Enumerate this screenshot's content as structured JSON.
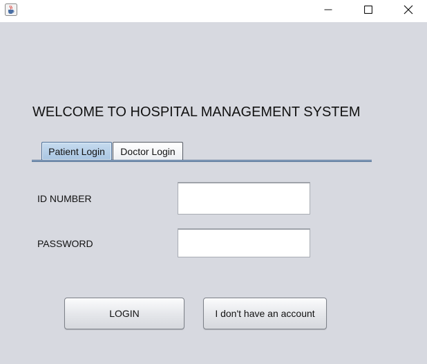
{
  "window": {
    "icon": "java-cup-icon",
    "controls": [
      "minimize-icon",
      "maximize-icon",
      "close-icon"
    ]
  },
  "main": {
    "welcome_text": "WELCOME TO HOSPITAL MANAGEMENT SYSTEM",
    "tabs": [
      {
        "label": "Patient Login",
        "selected": true
      },
      {
        "label": "Doctor Login",
        "selected": false
      }
    ],
    "form": {
      "id_label": "ID NUMBER",
      "id_value": "",
      "password_label": "PASSWORD",
      "password_value": ""
    },
    "buttons": {
      "login": "LOGIN",
      "no_account": "I don't have an account"
    }
  },
  "colors": {
    "background": "#d7d9e0",
    "selected_tab": "#b8d1ea",
    "tab_border": "#3f5f86"
  }
}
